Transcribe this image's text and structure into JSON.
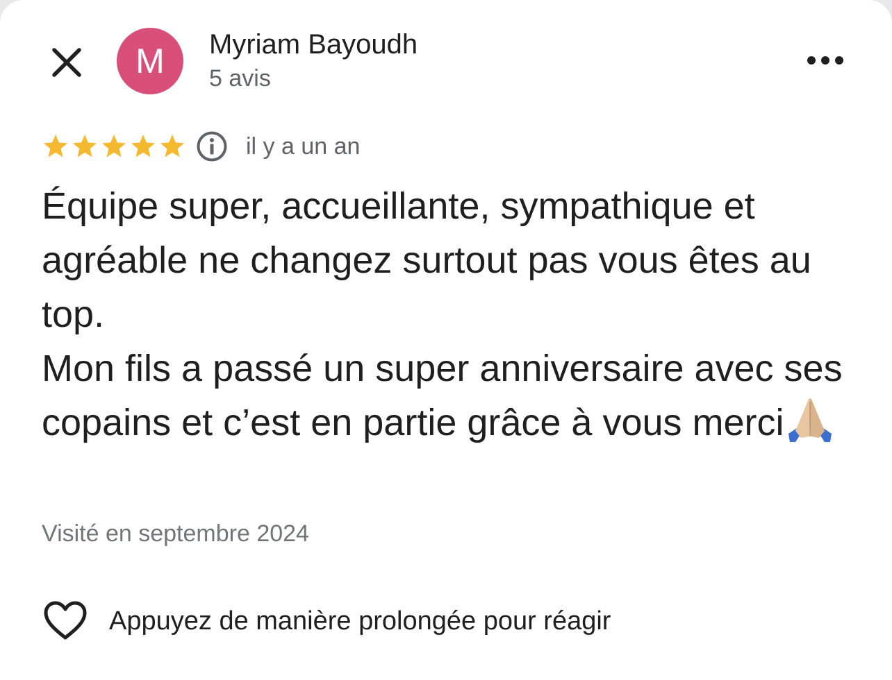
{
  "author": {
    "initial": "M",
    "name": "Myriam Bayoudh",
    "review_count": "5 avis",
    "avatar_color": "#d84f7a"
  },
  "review": {
    "rating": 5,
    "rating_max": 5,
    "star_color": "#f5b92f",
    "date": "il y a un an",
    "paragraph_1": "Équipe super, accueillante, sympathique et agréable ne changez surtout pas vous êtes au top.",
    "paragraph_2": "Mon fils a passé un super anniversaire avec ses copains et c’est en partie grâce à vous merci",
    "visited": "Visité en septembre 2024"
  },
  "actions": {
    "react_label": "Appuyez de manière prolongée pour réagir"
  },
  "icons": {
    "close": "close-icon",
    "more": "more-options-icon",
    "info": "info-icon",
    "heart": "heart-icon",
    "emoji": "folded-hands-emoji"
  }
}
